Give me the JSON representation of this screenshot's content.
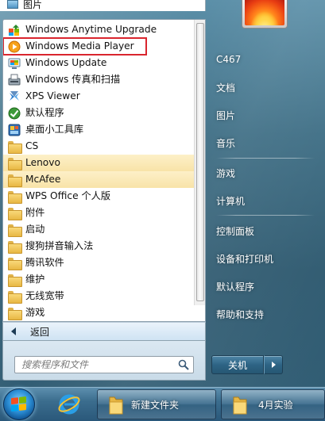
{
  "top_strip": {
    "label": "图片"
  },
  "programs": [
    {
      "label": "Windows Anytime Upgrade",
      "icon": "upgrade-icon"
    },
    {
      "label": "Windows Media Player",
      "icon": "media-player-icon"
    },
    {
      "label": "Windows Update",
      "icon": "windows-update-icon"
    },
    {
      "label": "Windows 传真和扫描",
      "icon": "fax-scan-icon"
    },
    {
      "label": "XPS Viewer",
      "icon": "xps-viewer-icon"
    },
    {
      "label": "默认程序",
      "icon": "default-programs-icon"
    },
    {
      "label": "桌面小工具库",
      "icon": "gadgets-icon"
    },
    {
      "label": "CS",
      "icon": "folder-icon"
    },
    {
      "label": "Lenovo",
      "icon": "folder-icon"
    },
    {
      "label": "McAfee",
      "icon": "folder-icon"
    },
    {
      "label": "WPS Office 个人版",
      "icon": "folder-icon"
    },
    {
      "label": "附件",
      "icon": "folder-icon"
    },
    {
      "label": "启动",
      "icon": "folder-icon"
    },
    {
      "label": "搜狗拼音输入法",
      "icon": "folder-icon"
    },
    {
      "label": "腾讯软件",
      "icon": "folder-icon"
    },
    {
      "label": "维护",
      "icon": "folder-icon"
    },
    {
      "label": "无线宽带",
      "icon": "folder-icon"
    },
    {
      "label": "游戏",
      "icon": "folder-icon"
    }
  ],
  "back": {
    "label": "返回"
  },
  "search": {
    "placeholder": "搜索程序和文件"
  },
  "right_panel": {
    "items": [
      {
        "label": "C467"
      },
      {
        "label": "文档"
      },
      {
        "label": "图片"
      },
      {
        "label": "音乐"
      },
      {
        "label": "游戏"
      },
      {
        "label": "计算机"
      },
      {
        "label": "控制面板"
      },
      {
        "label": "设备和打印机"
      },
      {
        "label": "默认程序"
      },
      {
        "label": "帮助和支持"
      }
    ]
  },
  "shutdown": {
    "label": "关机"
  },
  "taskbar": {
    "items": [
      {
        "label": "新建文件夹"
      },
      {
        "label": "4月实验"
      }
    ]
  },
  "colors": {
    "highlight": "#f8e3a8",
    "red_box": "#d9252e",
    "glass": "#3d6d84"
  }
}
